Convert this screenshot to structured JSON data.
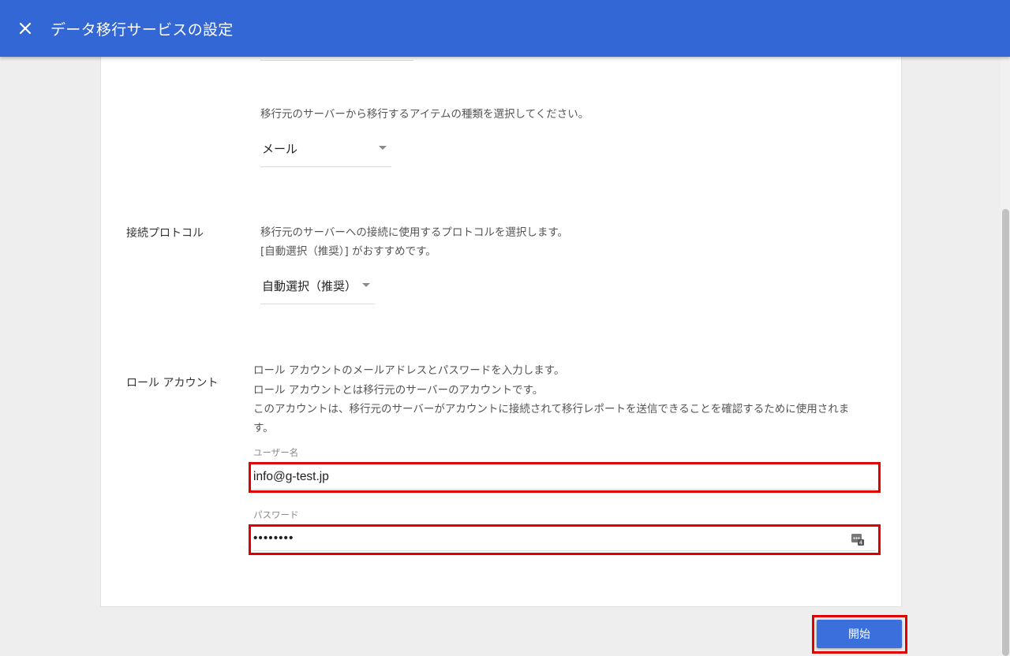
{
  "header": {
    "title": "データ移行サービスの設定",
    "bg_color": "#3367d6"
  },
  "item_type": {
    "description": "移行元のサーバーから移行するアイテムの種類を選択してください。",
    "selected": "メール"
  },
  "protocol": {
    "label": "接続プロトコル",
    "description_line1": "移行元のサーバーへの接続に使用するプロトコルを選択します。",
    "description_line2": "[自動選択（推奨）] がおすすめです。",
    "selected": "自動選択（推奨）"
  },
  "role_account": {
    "label": "ロール アカウント",
    "description_line1": "ロール アカウントのメールアドレスとパスワードを入力します。",
    "description_line2": "ロール アカウントとは移行元のサーバーのアカウントです。",
    "description_line3": "このアカウントは、移行元のサーバーがアカウントに接続されて移行レポートを送信できることを確認するために使用されま",
    "description_line4": "す。",
    "username_label": "ユーザー名",
    "username_value": "info@g-test.jp",
    "password_label": "パスワード",
    "password_value": "••••••••",
    "password_reveal_icon": "password-dots-icon"
  },
  "actions": {
    "start_label": "開始"
  },
  "colors": {
    "highlight": "#e00000",
    "primary_button": "#3b6fdc"
  }
}
